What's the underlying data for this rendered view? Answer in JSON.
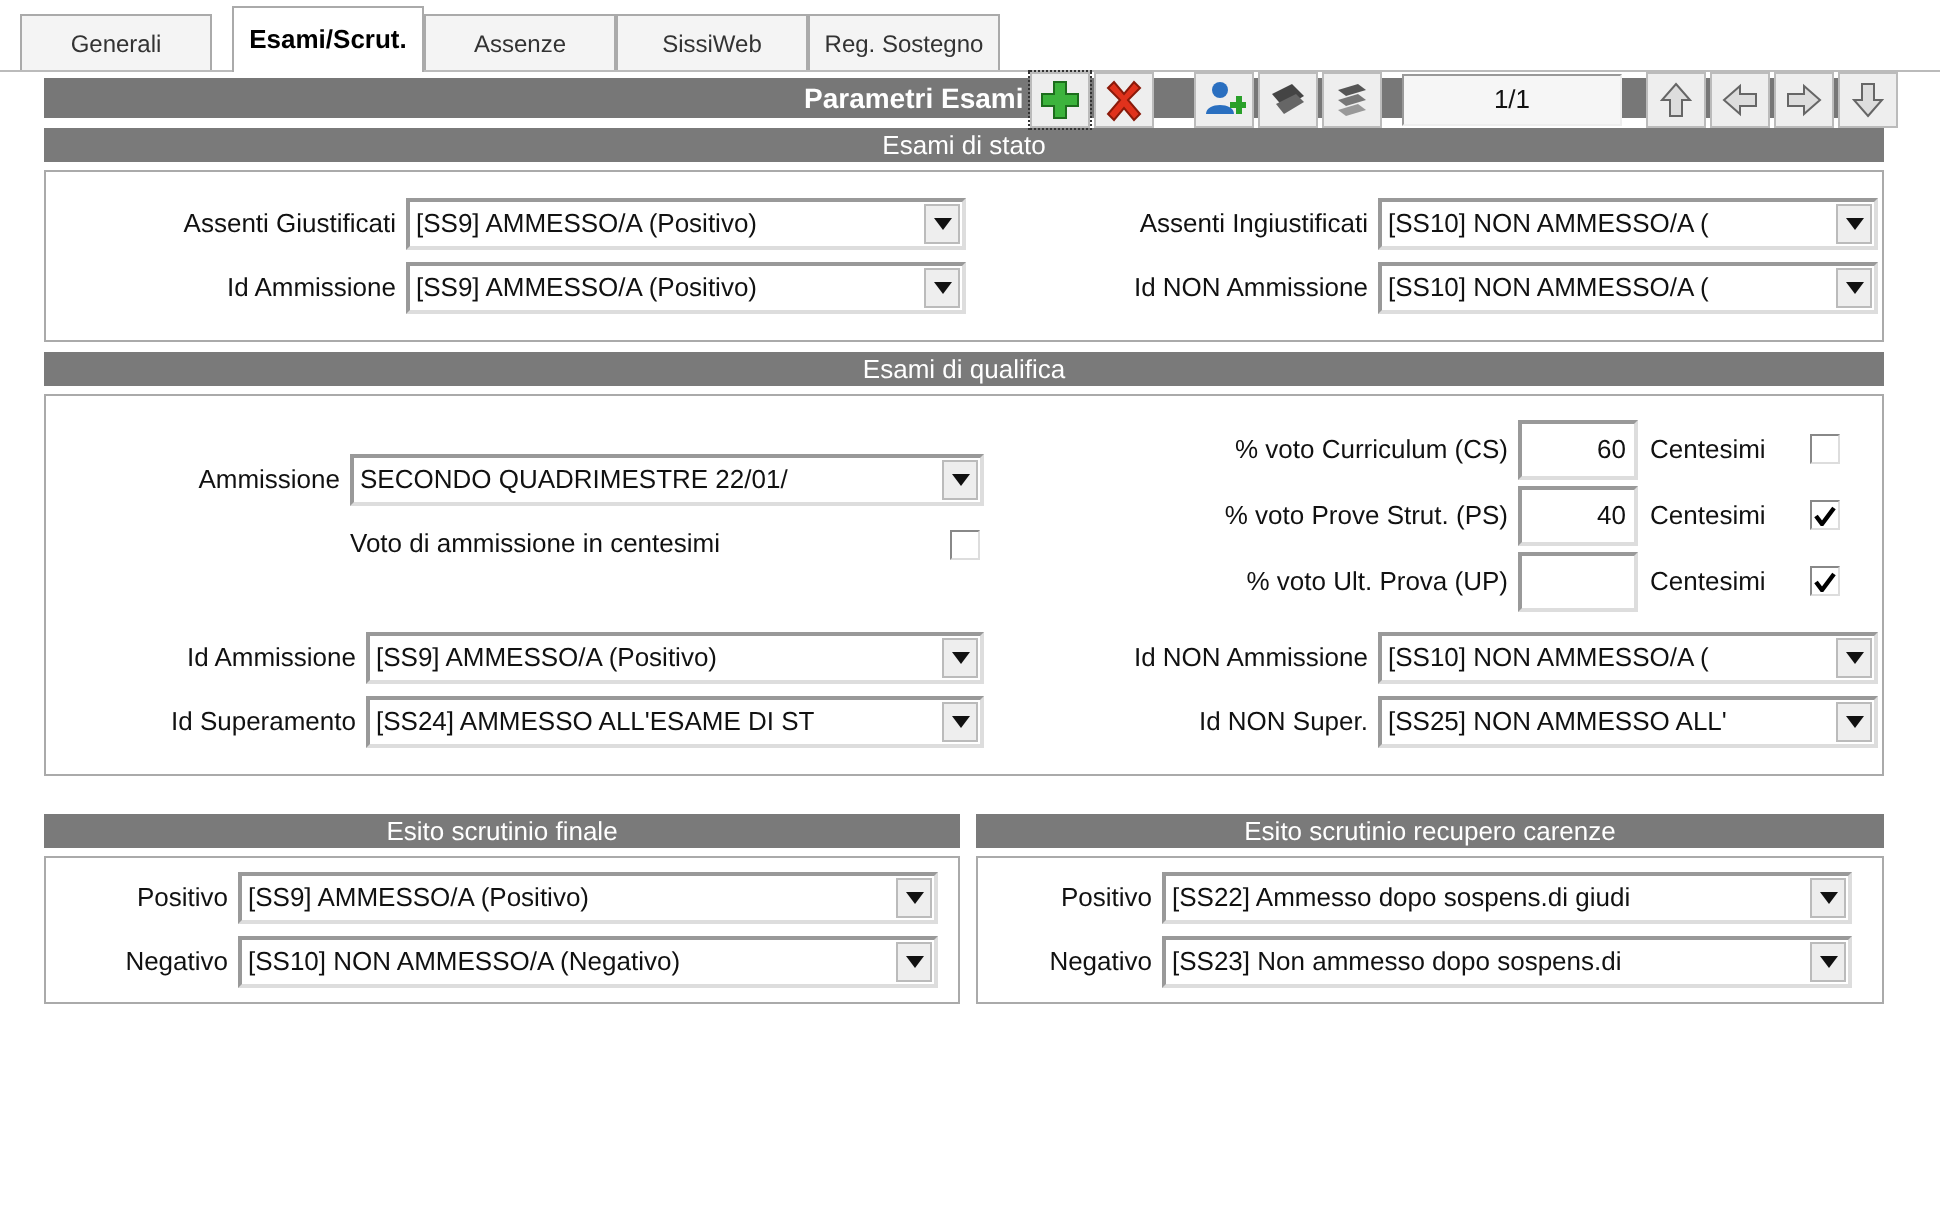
{
  "tabs": [
    {
      "label": "Generali",
      "selected": false
    },
    {
      "label": "Esami/Scrut.",
      "selected": true
    },
    {
      "label": "Assenze",
      "selected": false
    },
    {
      "label": "SissiWeb",
      "selected": false
    },
    {
      "label": "Reg. Sostegno",
      "selected": false
    }
  ],
  "title": "Parametri Esami",
  "toolbar": {
    "record_counter": "1/1"
  },
  "esami_di_stato": {
    "heading": "Esami di stato",
    "fields": [
      {
        "label": "Assenti Giustificati",
        "value": "[SS9] AMMESSO/A (Positivo)"
      },
      {
        "label": "Assenti Ingiustificati",
        "value": "[SS10] NON AMMESSO/A ("
      },
      {
        "label": "Id Ammissione",
        "value": "[SS9] AMMESSO/A (Positivo)"
      },
      {
        "label": "Id NON Ammissione",
        "value": "[SS10] NON AMMESSO/A ("
      }
    ]
  },
  "esami_di_qualifica": {
    "heading": "Esami di qualifica",
    "ammissione": {
      "label": "Ammissione",
      "value": "SECONDO QUADRIMESTRE 22/01/"
    },
    "voto_centesimi": {
      "label": "Voto di ammissione in centesimi",
      "checked": false
    },
    "percentages": [
      {
        "label": "% voto Curriculum (CS)",
        "value": "60",
        "centesimi_label": "Centesimi",
        "checked": false
      },
      {
        "label": "% voto Prove Strut. (PS)",
        "value": "40",
        "centesimi_label": "Centesimi",
        "checked": true
      },
      {
        "label": "% voto Ult. Prova (UP)",
        "centesimi_label": "Centesimi",
        "checked": true
      }
    ],
    "fields": [
      {
        "label": "Id Ammissione",
        "value": "[SS9] AMMESSO/A (Positivo)"
      },
      {
        "label": "Id NON Ammissione",
        "value": "[SS10] NON AMMESSO/A ("
      },
      {
        "label": "Id Superamento",
        "value": "[SS24] AMMESSO ALL'ESAME DI ST"
      },
      {
        "label": "Id NON Super.",
        "value": "[SS25] NON AMMESSO ALL'"
      }
    ]
  },
  "esito_scrutinio_finale": {
    "heading": "Esito scrutinio finale",
    "fields": [
      {
        "label": "Positivo",
        "value": "[SS9] AMMESSO/A (Positivo)"
      },
      {
        "label": "Negativo",
        "value": "[SS10] NON AMMESSO/A (Negativo)"
      }
    ]
  },
  "esito_recupero_carenze": {
    "heading": "Esito scrutinio recupero carenze",
    "fields": [
      {
        "label": "Positivo",
        "value": "[SS22] Ammesso dopo sospens.di giudi"
      },
      {
        "label": "Negativo",
        "value": "[SS23] Non ammesso dopo sospens.di"
      }
    ]
  }
}
